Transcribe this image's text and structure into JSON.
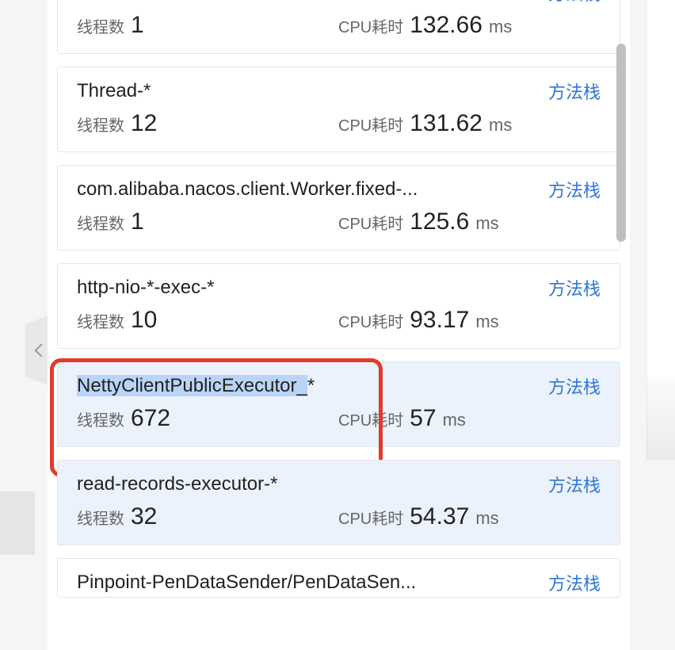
{
  "labels": {
    "thread_count": "线程数",
    "cpu_time": "CPU耗时",
    "method_stack": "方法栈",
    "ms_unit": "ms"
  },
  "cards": [
    {
      "name": "",
      "thread_count": "1",
      "cpu_time": "132.66",
      "selected": false,
      "highlighted": false,
      "highlight_name_prefix": ""
    },
    {
      "name": "Thread-*",
      "thread_count": "12",
      "cpu_time": "131.62",
      "selected": false,
      "highlighted": false,
      "highlight_name_prefix": ""
    },
    {
      "name": "com.alibaba.nacos.client.Worker.fixed-...",
      "thread_count": "1",
      "cpu_time": "125.6",
      "selected": false,
      "highlighted": false,
      "highlight_name_prefix": ""
    },
    {
      "name": "http-nio-*-exec-*",
      "thread_count": "10",
      "cpu_time": "93.17",
      "selected": false,
      "highlighted": false,
      "highlight_name_prefix": ""
    },
    {
      "name": "NettyClientPublicExecutor_*",
      "thread_count": "672",
      "cpu_time": "57",
      "selected": true,
      "highlighted": true,
      "highlight_name_prefix": "NettyClientPublicExecutor_",
      "name_suffix": "*"
    },
    {
      "name": "read-records-executor-*",
      "thread_count": "32",
      "cpu_time": "54.37",
      "selected": true,
      "highlighted": false,
      "highlight_name_prefix": ""
    },
    {
      "name": "Pinpoint-PenDataSender/PenDataSen...",
      "thread_count": "",
      "cpu_time": "",
      "selected": false,
      "highlighted": false,
      "highlight_name_prefix": ""
    }
  ]
}
